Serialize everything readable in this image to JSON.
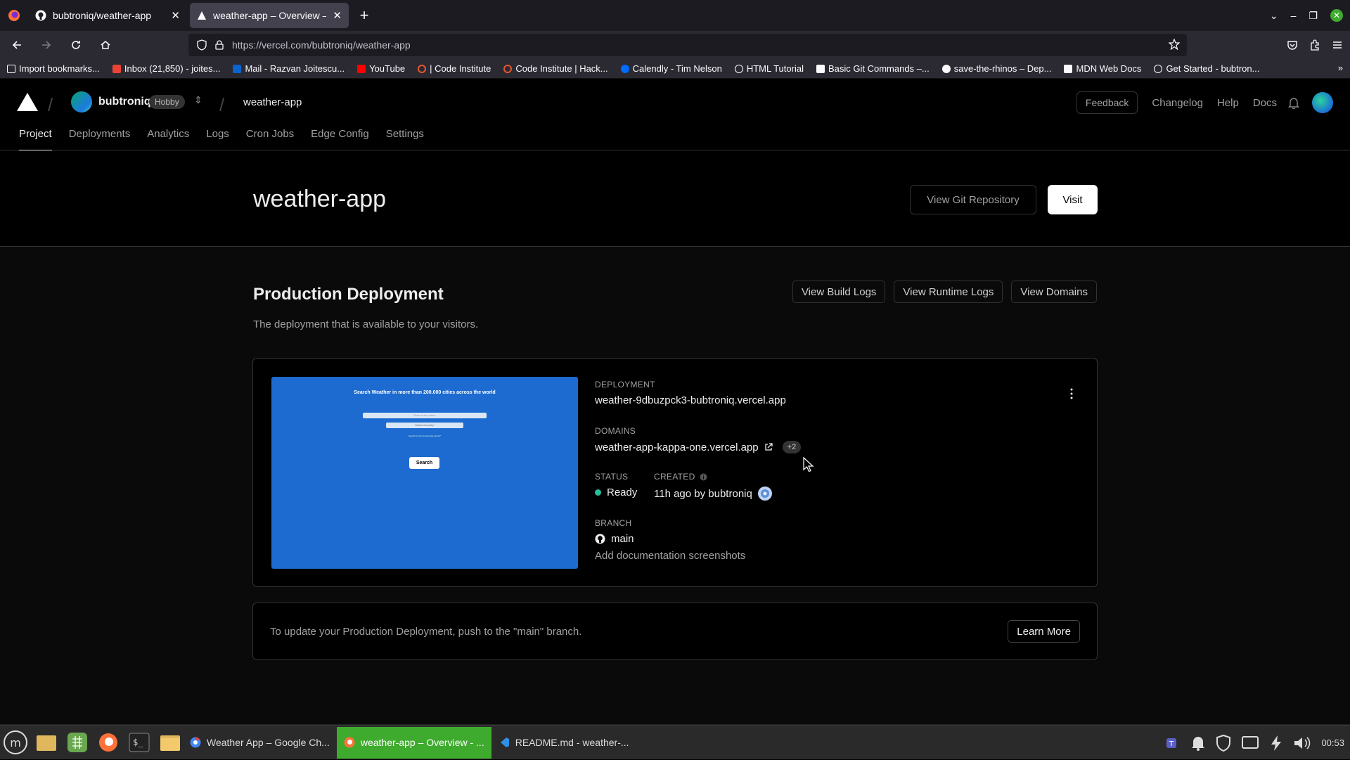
{
  "browser": {
    "tabs": [
      {
        "title": "bubtroniq/weather-app",
        "active": false
      },
      {
        "title": "weather-app – Overview – V",
        "active": true
      }
    ],
    "url": "https://vercel.com/bubtroniq/weather-app",
    "bookmarks": [
      "Import bookmarks...",
      "Inbox (21,850) - joites...",
      "Mail - Razvan Joitescu...",
      "YouTube",
      "| Code Institute",
      "Code Institute | Hack...",
      "Calendly - Tim Nelson",
      "HTML Tutorial",
      "Basic Git Commands –...",
      "save-the-rhinos – Dep...",
      "MDN Web Docs",
      "Get Started - bubtron..."
    ]
  },
  "header": {
    "team": "bubtroniq",
    "plan": "Hobby",
    "project": "weather-app",
    "feedback": "Feedback",
    "links": [
      "Changelog",
      "Help",
      "Docs"
    ]
  },
  "tabs": [
    "Project",
    "Deployments",
    "Analytics",
    "Logs",
    "Cron Jobs",
    "Edge Config",
    "Settings"
  ],
  "title_band": {
    "title": "weather-app",
    "view_git": "View Git Repository",
    "visit": "Visit"
  },
  "production": {
    "heading": "Production Deployment",
    "subheading": "The deployment that is available to your visitors.",
    "buttons": [
      "View Build Logs",
      "View Runtime Logs",
      "View Domains"
    ],
    "preview": {
      "title": "Search Weather in more than 200.000 cities across the world",
      "input_placeholder": "Enter a city name",
      "select_label": "Select Country*",
      "note": "Search by city for accurate search*",
      "button": "Search"
    },
    "deployment_label": "Deployment",
    "deployment": "weather-9dbuzpck3-bubtroniq.vercel.app",
    "domains_label": "Domains",
    "domain": "weather-app-kappa-one.vercel.app",
    "domains_extra": "+2",
    "status_label": "Status",
    "status": "Ready",
    "status_color": "#29bc9b",
    "created_label": "Created",
    "created": "11h ago by bubtroniq",
    "branch_label": "Branch",
    "branch": "main",
    "commit": "Add documentation screenshots"
  },
  "info": {
    "text": "To update your Production Deployment, push to the \"main\" branch.",
    "button": "Learn More"
  },
  "taskbar": {
    "windows": [
      {
        "title": "Weather App – Google Ch...",
        "active": false
      },
      {
        "title": "weather-app – Overview - ...",
        "active": true
      },
      {
        "title": "README.md - weather-...",
        "active": false
      }
    ],
    "clock": "00:53"
  }
}
